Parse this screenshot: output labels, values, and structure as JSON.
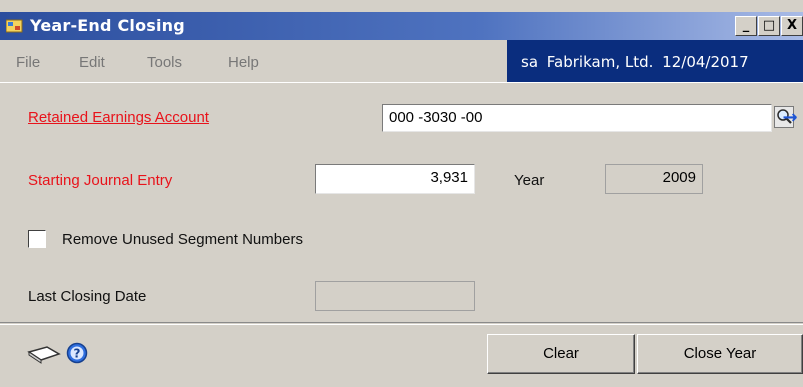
{
  "window": {
    "title": "Year-End Closing",
    "controls": {
      "minimize": "_",
      "maximize": "□",
      "close": "X"
    }
  },
  "menu": {
    "items": [
      "File",
      "Edit",
      "Tools",
      "Help"
    ]
  },
  "company_bar": {
    "user": "sa",
    "company": "Fabrikam, Ltd.",
    "date": "12/04/2017"
  },
  "form": {
    "retained_earnings": {
      "label": "Retained Earnings Account",
      "value": "000 -3030 -00"
    },
    "starting_journal_entry": {
      "label": "Starting Journal Entry",
      "value": "3,931"
    },
    "year": {
      "label": "Year",
      "value": "2009"
    },
    "remove_unused": {
      "label": "Remove Unused Segment Numbers",
      "checked": false
    },
    "last_closing_date": {
      "label": "Last Closing Date",
      "value": ""
    }
  },
  "icons": {
    "lookup": "magnifier-lookup-icon",
    "go_to": "arrow-right-icon",
    "note": "note-icon",
    "help": "help-icon"
  },
  "buttons": {
    "clear": "Clear",
    "close_year": "Close Year"
  },
  "colors": {
    "title_bar": "#2c4e9e",
    "company_bar": "#0a2d7e",
    "required_label": "#e8131b",
    "window_bg": "#d4d0c8"
  }
}
